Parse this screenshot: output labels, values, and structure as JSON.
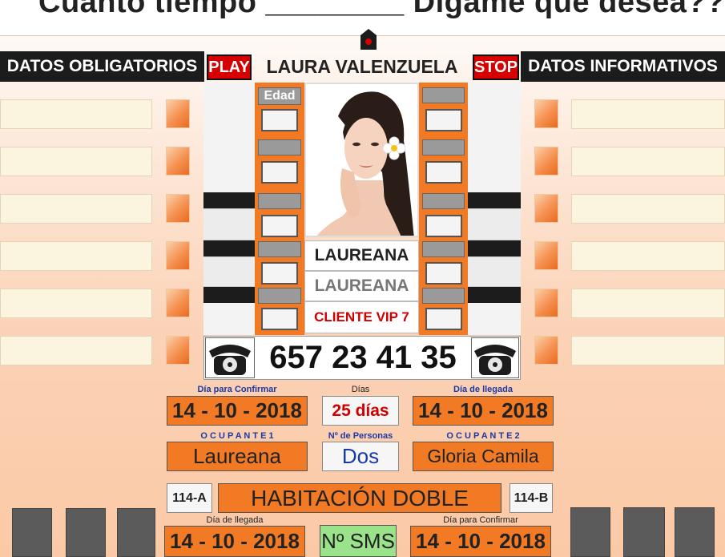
{
  "header": {
    "title": "Cuanto tiempo ________ Dígame que desea??",
    "left_section": "DATOS OBLIGATORIOS",
    "right_section": "DATOS INFORMATIVOS",
    "play_label": "PLAY",
    "stop_label": "STOP",
    "client_name": "LAURA VALENZUELA"
  },
  "profile": {
    "age_label": "Edad",
    "name_line_1": "LAUREANA",
    "name_line_2": "LAUREANA",
    "status": "CLIENTE VIP 7",
    "status_color": "#d10000"
  },
  "phone": {
    "number": "657 23 41 35"
  },
  "booking": {
    "confirm_label_top": "Día para Confirmar",
    "confirm_date_top": "14 - 10 - 2018",
    "days_label": "Días",
    "days_value": "25 días",
    "arrival_label_top": "Día  de llegada",
    "arrival_date_top": "14 - 10 - 2018",
    "occupant1_label": "O C U P A N T E  1",
    "occupant1_value": "Laureana",
    "persons_label": "Nº de Personas",
    "persons_value": "Dos",
    "occupant2_label": "O C U P A N T E  2",
    "occupant2_value": "Gloria Camila",
    "room_a": "114-A",
    "room_type": "HABITACIÓN  DOBLE",
    "room_b": "114-B",
    "arrival_label_bottom": "Día  de llegada",
    "arrival_date_bottom": "14 - 10 - 2018",
    "sms_label": "Nº SMS",
    "confirm_label_bottom": "Día para Confirmar",
    "confirm_date_bottom": "14 - 10 - 2018"
  },
  "colors": {
    "accent_orange": "#f27a25",
    "dark_bar": "#1c1c1c",
    "play_stop_red": "#d60000",
    "sms_green": "#9be38a",
    "days_red": "#d10000",
    "persons_blue": "#1a3aa8"
  },
  "icons": {
    "home": "home-icon",
    "phone": "telephone-icon"
  }
}
